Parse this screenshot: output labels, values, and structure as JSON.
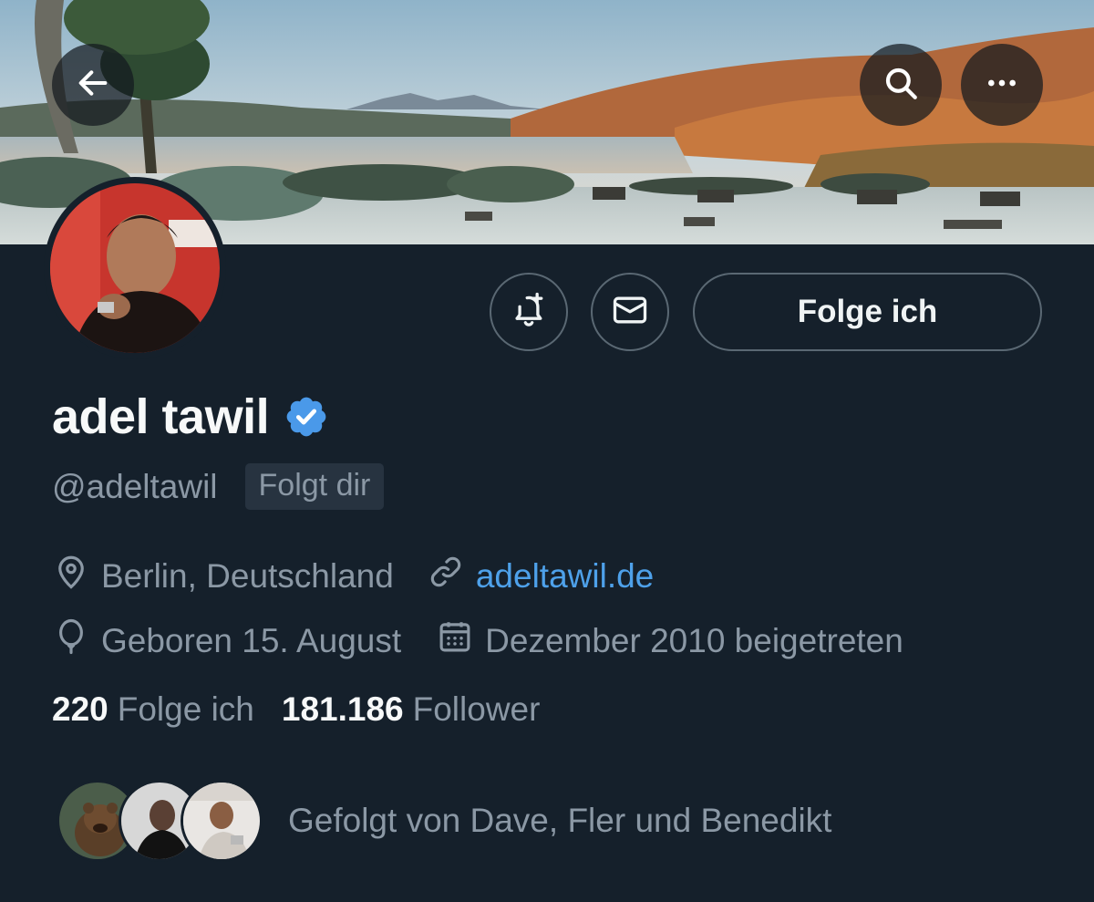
{
  "header": {
    "back_icon": "arrow-left-icon",
    "search_icon": "search-icon",
    "more_icon": "more-horizontal-icon"
  },
  "actions": {
    "notify_icon": "bell-plus-icon",
    "message_icon": "envelope-icon",
    "follow_label": "Folge ich"
  },
  "profile": {
    "name": "adel tawil",
    "verified_icon": "verified-badge-icon",
    "handle": "@adeltawil",
    "follows_you": "Folgt dir",
    "location": "Berlin, Deutschland",
    "website": "adeltawil.de",
    "birthday": "Geboren 15. August",
    "joined": "Dezember 2010 beigetreten"
  },
  "stats": {
    "following_count": "220",
    "following_label": "Folge ich",
    "followers_count": "181.186",
    "followers_label": "Follower"
  },
  "followed_by": {
    "text": "Gefolgt von Dave, Fler und Benedikt"
  },
  "colors": {
    "background": "#15202b",
    "accent_link": "#4ea1ea",
    "verified": "#4a99e9",
    "muted_text": "#8b98a5"
  }
}
